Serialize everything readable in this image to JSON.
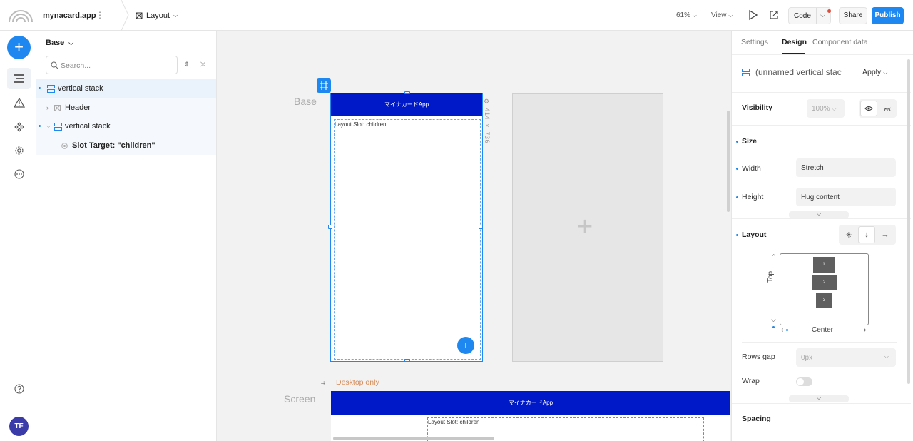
{
  "topbar": {
    "app_name": "mynacard.app",
    "app_menu": "⋮",
    "layout_label": "Layout",
    "zoom": "61%",
    "view_label": "View",
    "code_label": "Code",
    "share_label": "Share",
    "publish_label": "Publish"
  },
  "rail": {
    "avatar_initials": "TF"
  },
  "tree": {
    "title": "Base",
    "search_placeholder": "Search...",
    "nodes": [
      {
        "label": "vertical stack"
      },
      {
        "label": "Header"
      },
      {
        "label": "vertical stack"
      },
      {
        "label": "Slot Target: \"children\""
      }
    ]
  },
  "canvas": {
    "base_label": "Base",
    "screen_label": "Screen",
    "phone_title": "マイナカードApp",
    "slot_label": "Layout Slot: children",
    "dims": "414 × 736",
    "desktop_only_label": "Desktop only",
    "desktop_title": "マイナカードApp",
    "desktop_slot_label": "Layout Slot: children"
  },
  "panel": {
    "tabs": [
      "Settings",
      "Design",
      "Component data"
    ],
    "component_name": "(unnamed vertical stac",
    "apply_label": "Apply",
    "visibility_label": "Visibility",
    "opacity": "100%",
    "size_label": "Size",
    "width_label": "Width",
    "width_value": "Stretch",
    "height_label": "Height",
    "height_value": "Hug content",
    "layout_label": "Layout",
    "align_items": [
      "1",
      "2",
      "3"
    ],
    "vertical_align": "Top",
    "horizontal_align": "Center",
    "rows_gap_label": "Rows gap",
    "rows_gap_value": "0px",
    "wrap_label": "Wrap",
    "spacing_label": "Spacing"
  },
  "colors": {
    "accent": "#1e88f0",
    "header_blue": "#0019c8",
    "desktop_label": "#d88a55"
  }
}
